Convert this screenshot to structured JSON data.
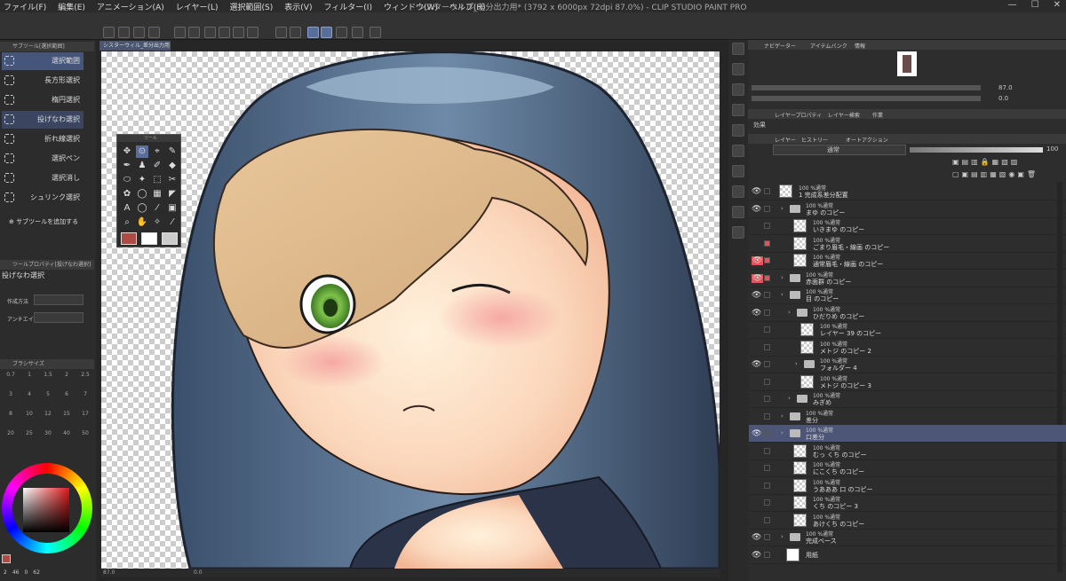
{
  "menu": [
    "ファイル(F)",
    "編集(E)",
    "アニメーション(A)",
    "レイヤー(L)",
    "選択範囲(S)",
    "表示(V)",
    "フィルター(I)",
    "ウィンドウ(W)",
    "ヘルプ(H)"
  ],
  "title": "シスターウィル_差分出力用* (3792 x 6000px 72dpi 87.0%) - CLIP STUDIO PAINT PRO",
  "doc_tab": "シスターウィル_差分出力用*",
  "subtool": {
    "header": "サブツール[選択範囲]",
    "items": [
      "選択範囲",
      "長方形選択",
      "楕円選択",
      "投げなわ選択",
      "折れ線選択",
      "選択ペン",
      "選択消し",
      "シュリンク選択"
    ],
    "add": "サブツールを追加する"
  },
  "toolprop": {
    "header": "ツールプロパティ[投げなわ選択]",
    "name": "投げなわ選択",
    "mode_label": "作成方法",
    "aa_label": "アンチエイ"
  },
  "brushsize": {
    "header": "ブラシサイズ",
    "values": [
      "0.7",
      "1",
      "1.5",
      "2",
      "2.5",
      "3",
      "4",
      "5",
      "6",
      "7",
      "8",
      "10",
      "12",
      "15",
      "17",
      "20",
      "25",
      "30",
      "40",
      "50"
    ]
  },
  "color": {
    "main": "#b04a44",
    "sub": "#ffffff",
    "footer": [
      "2",
      "46",
      "0",
      "62"
    ]
  },
  "toolwin": {
    "title": "ツール"
  },
  "status": {
    "zoom": "87.0",
    "angle": "0.0"
  },
  "navigator": {
    "tabs": [
      "ナビゲーター",
      "アイテムバンク",
      "情報"
    ],
    "zoom": "87.0",
    "rot": "0.0"
  },
  "layerprop": {
    "tabs": [
      "レイヤープロパティ",
      "レイヤー検索",
      "作業"
    ],
    "effect": "効果"
  },
  "layers": {
    "tabs": [
      "レイヤー",
      "ヒストリー",
      "オートアクション"
    ],
    "blend": "通常",
    "opacity": "100",
    "rows": [
      {
        "mode": "100 %通常",
        "name": "1 完成系差分配置",
        "ind": 0,
        "t": "thumb",
        "eye": "👁",
        "red": false
      },
      {
        "mode": "100 %通常",
        "name": "まゆ のコピー",
        "ind": 1,
        "t": "folder",
        "eye": "👁",
        "red": false
      },
      {
        "mode": "100 %通常",
        "name": "いきまゆ のコピー",
        "ind": 2,
        "t": "thumb",
        "eye": "",
        "red": false
      },
      {
        "mode": "100 %通常",
        "name": "ごまり眉毛・線画 のコピー",
        "ind": 2,
        "t": "thumb",
        "eye": "",
        "red": true
      },
      {
        "mode": "100 %通常",
        "name": "通常眉毛・線画 のコピー",
        "ind": 2,
        "t": "thumb",
        "eye": "👁",
        "red": true
      },
      {
        "mode": "100 %通常",
        "name": "赤面群 のコピー",
        "ind": 1,
        "t": "folder",
        "eye": "👁",
        "red": true
      },
      {
        "mode": "100 %通常",
        "name": "目 のコピー",
        "ind": 1,
        "t": "folder",
        "eye": "👁",
        "red": false
      },
      {
        "mode": "100 %通常",
        "name": "ひだりめ のコピー",
        "ind": 2,
        "t": "folder",
        "eye": "👁",
        "red": false
      },
      {
        "mode": "100 %通常",
        "name": "レイヤー 39 のコピー",
        "ind": 3,
        "t": "thumb",
        "eye": "",
        "red": false
      },
      {
        "mode": "100 %通常",
        "name": "メトジ のコピー 2",
        "ind": 3,
        "t": "thumb",
        "eye": "",
        "red": false
      },
      {
        "mode": "100 %通常",
        "name": "フォルダー 4",
        "ind": 3,
        "t": "folder",
        "eye": "👁",
        "red": false
      },
      {
        "mode": "100 %通常",
        "name": "メトジ のコピー 3",
        "ind": 3,
        "t": "thumb",
        "eye": "",
        "red": false
      },
      {
        "mode": "100 %通常",
        "name": "みぎめ",
        "ind": 2,
        "t": "folder",
        "eye": "",
        "red": false
      },
      {
        "mode": "100 %通常",
        "name": "差分",
        "ind": 1,
        "t": "folder",
        "eye": "",
        "red": false
      },
      {
        "mode": "100 %通常",
        "name": "口差分",
        "ind": 1,
        "t": "folder",
        "eye": "👁",
        "red": false,
        "sel": true
      },
      {
        "mode": "100 %通常",
        "name": "むっ くち のコピー",
        "ind": 2,
        "t": "thumb",
        "eye": "",
        "red": false
      },
      {
        "mode": "100 %通常",
        "name": "にこくち のコピー",
        "ind": 2,
        "t": "thumb",
        "eye": "",
        "red": false
      },
      {
        "mode": "100 %通常",
        "name": "うあああ 口 のコピー",
        "ind": 2,
        "t": "thumb",
        "eye": "",
        "red": false
      },
      {
        "mode": "100 %通常",
        "name": "くち のコピー 3",
        "ind": 2,
        "t": "thumb",
        "eye": "",
        "red": false
      },
      {
        "mode": "100 %通常",
        "name": "あけくち のコピー",
        "ind": 2,
        "t": "thumb",
        "eye": "",
        "red": false
      },
      {
        "mode": "100 %通常",
        "name": "完成ベース",
        "ind": 1,
        "t": "folder",
        "eye": "👁",
        "red": false
      },
      {
        "mode": "",
        "name": "用紙",
        "ind": 1,
        "t": "paper",
        "eye": "👁",
        "red": false
      }
    ]
  }
}
